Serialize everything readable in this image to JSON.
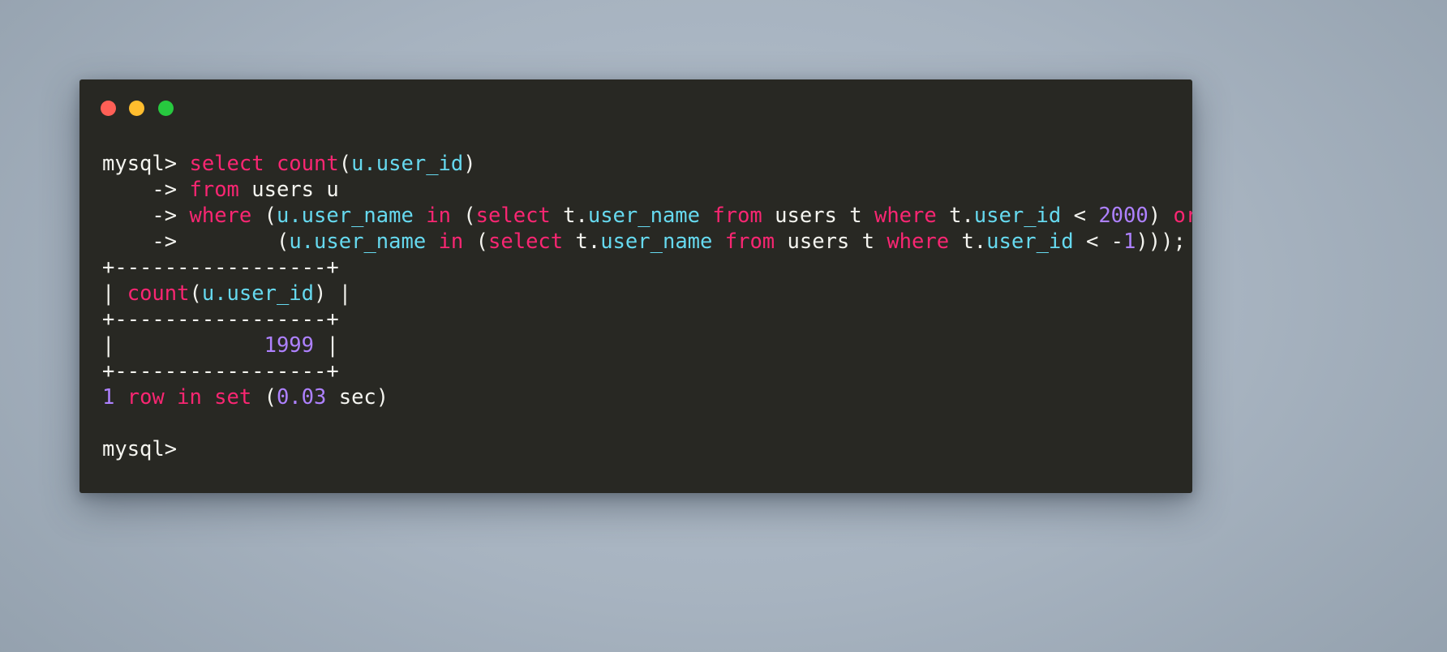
{
  "window": {
    "title_bar": {
      "buttons": [
        {
          "name": "close",
          "color": "#ff5f56"
        },
        {
          "name": "minimize",
          "color": "#ffbd2e"
        },
        {
          "name": "maximize",
          "color": "#27c93f"
        }
      ]
    },
    "background_color": "#282823",
    "foreground_color": "#f4f4ef"
  },
  "theme": {
    "keyword_color": "#f92672",
    "identifier_color": "#66d9ef",
    "number_color": "#ae81ff",
    "plain_color": "#f4f4ef",
    "desktop_color": "#a8b4c0"
  },
  "terminal": {
    "prompt": "mysql>",
    "continuation_prompt": "->",
    "lines": {
      "l1": {
        "prompt": "mysql> ",
        "kw_select": "select",
        "sp1": " ",
        "kw_count": "count",
        "paren_open": "(",
        "id_col": "u.user_id",
        "paren_close": ")"
      },
      "l2": {
        "indent": "    ",
        "cont": "-> ",
        "kw_from": "from",
        "rest": " users u"
      },
      "l3": {
        "indent": "    ",
        "cont": "-> ",
        "kw_where": "where",
        "p1": " (",
        "id_a": "u.user_name",
        "sp1": " ",
        "kw_in": "in",
        "p2": " (",
        "kw_select": "select",
        "p3": " t.",
        "id_b": "user_name",
        "sp2": " ",
        "kw_from": "from",
        "p4": " users t ",
        "kw_where2": "where",
        "p5": " t.",
        "id_c": "user_id",
        "p6": " < ",
        "num": "2000",
        "p7": ") ",
        "kw_or": "or"
      },
      "l4": {
        "indent": "    ",
        "cont": "->",
        "pad": "        ",
        "p1": "(",
        "id_a": "u.user_name",
        "sp1": " ",
        "kw_in": "in",
        "p2": " (",
        "kw_select": "select",
        "p3": " t.",
        "id_b": "user_name",
        "sp2": " ",
        "kw_from": "from",
        "p4": " users t ",
        "kw_where": "where",
        "p5": " t.",
        "id_c": "user_id",
        "p6": " < -",
        "num": "1",
        "p7": ")));"
      },
      "border_top": "+-----------------+",
      "header_row": {
        "pipe_left": "| ",
        "kw_count": "count",
        "paren_open": "(",
        "id_col": "u.user_id",
        "paren_close": ")",
        "pipe_right": " |"
      },
      "border_mid": "+-----------------+",
      "value_row": {
        "pipe_left": "|",
        "pad": "            ",
        "value": "1999",
        "pipe_right": " |"
      },
      "border_bottom": "+-----------------+",
      "status": {
        "count": "1",
        "text_a": " row in set ",
        "paren_open": "(",
        "seconds": "0.03",
        "text_b": " sec)"
      },
      "final_prompt": "mysql>"
    }
  }
}
